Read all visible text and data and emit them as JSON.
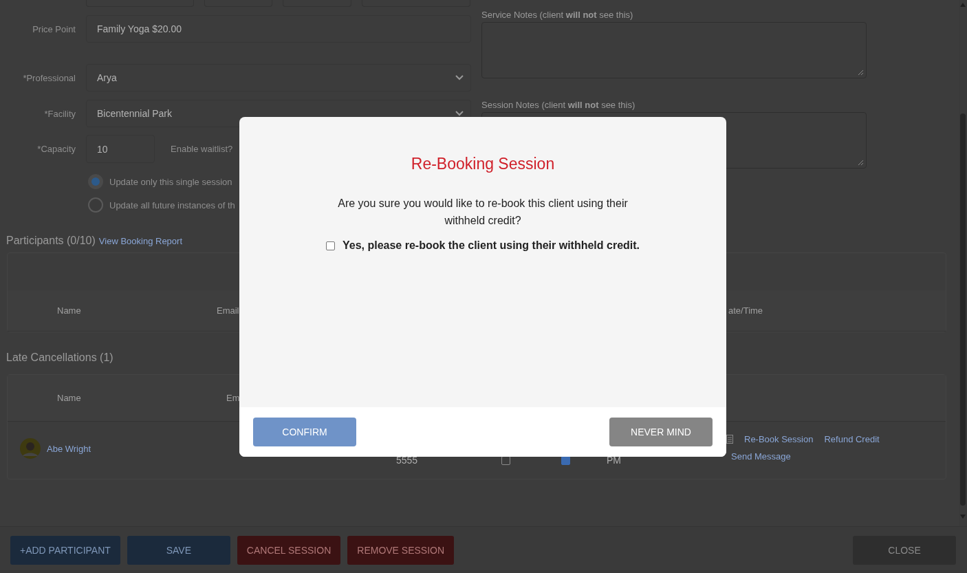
{
  "form": {
    "price_point": {
      "label": "Price Point",
      "value": "Family Yoga $20.00"
    },
    "professional": {
      "label": "*Professional",
      "value": "Arya"
    },
    "facility": {
      "label": "*Facility",
      "value": "Bicentennial Park"
    },
    "capacity": {
      "label": "*Capacity",
      "value": "10"
    },
    "waitlist_label": "Enable waitlist?",
    "update_options": [
      {
        "label": "Update only this single session",
        "selected": true
      },
      {
        "label": "Update all future instances of th",
        "selected": false
      }
    ]
  },
  "notes": [
    {
      "label": "Service Notes (client **will not** see this)"
    },
    {
      "label": "Session Notes (client **will not** see this)"
    }
  ],
  "participants": {
    "title": "Participants (0/10)",
    "link": "View Booking Report",
    "columns": [
      "Name",
      "Email",
      "ate/Time"
    ]
  },
  "late_cancellations": {
    "title": "Late Cancellations (1)",
    "columns": [
      "Name",
      "Em"
    ],
    "rows": [
      {
        "name": "Abe Wright",
        "phone": "5555",
        "check_1": false,
        "check_2": true,
        "time": "PM",
        "actions": [
          "Re-Book Session",
          "Refund Credit",
          "Send Message"
        ]
      }
    ]
  },
  "footer_buttons": [
    {
      "label": "+ADD PARTICIPANT",
      "kind": "primary"
    },
    {
      "label": "SAVE",
      "kind": "primary"
    },
    {
      "label": "CANCEL SESSION",
      "kind": "danger"
    },
    {
      "label": "REMOVE SESSION",
      "kind": "danger"
    },
    {
      "label": "CLOSE",
      "kind": "neutral"
    }
  ],
  "modal": {
    "title": "Re-Booking Session",
    "message": "Are you sure you would like to re-book this client using their withheld credit?",
    "checkbox": {
      "label": "Yes, please re-book the client using their withheld credit.",
      "checked": false
    },
    "buttons": [
      {
        "label": "CONFIRM",
        "kind": "confirm"
      },
      {
        "label": "NEVER MIND",
        "kind": "cancel"
      }
    ]
  }
}
